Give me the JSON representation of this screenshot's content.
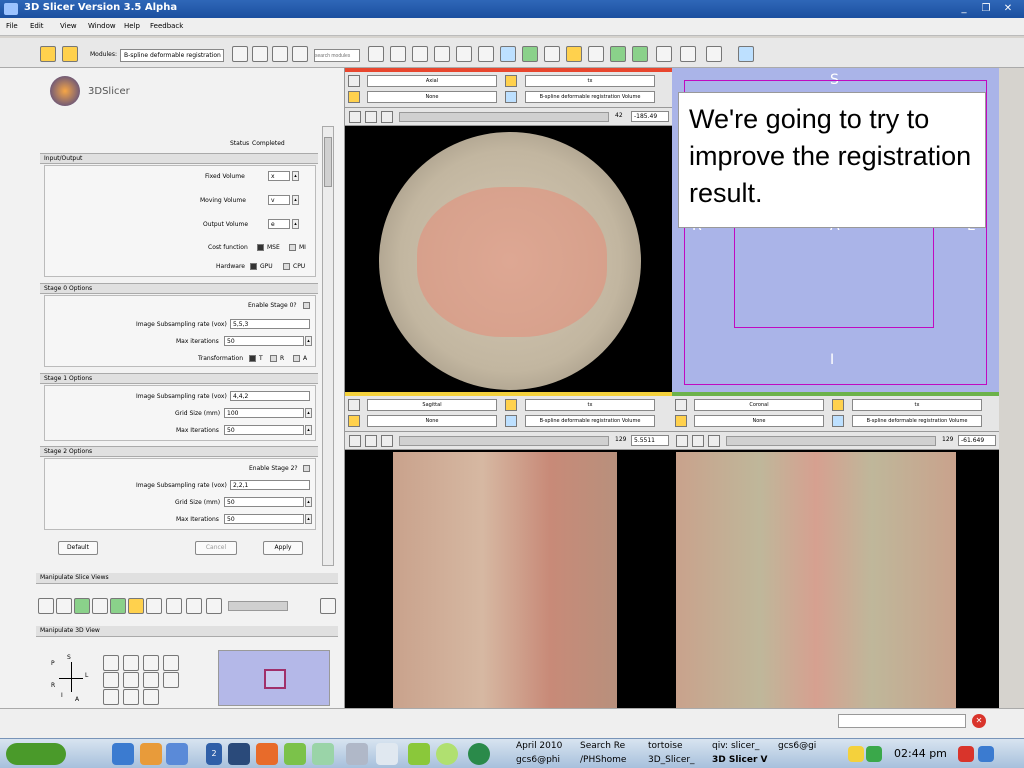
{
  "window": {
    "title": "3D Slicer Version 3.5 Alpha"
  },
  "menu": [
    "File",
    "Edit",
    "View",
    "Window",
    "Help",
    "Feedback"
  ],
  "toolbar": {
    "modules_label": "Modules:",
    "module_select": "B-spline deformable registration",
    "search_placeholder": "search modules"
  },
  "logo": {
    "text": "3DSlicer"
  },
  "module": {
    "status_label": "Status",
    "status_value": "Completed",
    "io_section": "Input/Output",
    "fixed_label": "Fixed Volume",
    "fixed_value": "x",
    "moving_label": "Moving Volume",
    "moving_value": "v",
    "output_label": "Output Volume",
    "output_value": "e",
    "cost_label": "Cost function",
    "cost_opt1": "MSE",
    "cost_opt2": "MI",
    "hw_label": "Hardware",
    "hw_opt1": "GPU",
    "hw_opt2": "CPU",
    "stage0_section": "Stage 0 Options",
    "stage0_enable": "Enable Stage 0?",
    "stage0_subsamp_label": "Image Subsampling rate (vox)",
    "stage0_subsamp_value": "5,5,3",
    "stage0_maxit_label": "Max iterations",
    "stage0_maxit_value": "50",
    "stage0_transform_label": "Transformation",
    "transform_t": "T",
    "transform_r": "R",
    "transform_a": "A",
    "stage1_section": "Stage 1 Options",
    "stage1_subsamp_label": "Image Subsampling rate (vox)",
    "stage1_subsamp_value": "4,4,2",
    "stage1_grid_label": "Grid Size (mm)",
    "stage1_grid_value": "100",
    "stage1_maxit_label": "Max Iterations",
    "stage1_maxit_value": "50",
    "stage2_section": "Stage 2 Options",
    "stage2_enable": "Enable Stage 2?",
    "stage2_subsamp_label": "Image Subsampling rate (vox)",
    "stage2_subsamp_value": "2,2,1",
    "stage2_grid_label": "Grid Size (mm)",
    "stage2_grid_value": "50",
    "stage2_maxit_label": "Max Iterations",
    "stage2_maxit_value": "50",
    "default_button": "Default",
    "cancel_button": "Cancel",
    "apply_button": "Apply"
  },
  "manip_slice": {
    "title": "Manipulate Slice Views"
  },
  "manip_3d": {
    "title": "Manipulate 3D View",
    "orient": {
      "p": "P",
      "s": "S",
      "r": "R",
      "l": "L",
      "i": "I",
      "a": "A"
    }
  },
  "views": {
    "axial": {
      "orientation": "Axial",
      "fg": "tx",
      "lbl": "None",
      "bg": "B-spline deformable registration Volume",
      "slice": "42",
      "offset": "-185.49"
    },
    "sagittal": {
      "orientation": "Sagittal",
      "fg": "tx",
      "lbl": "None",
      "bg": "B-spline deformable registration Volume",
      "slice": "129",
      "offset": "5.5511"
    },
    "coronal": {
      "orientation": "Coronal",
      "fg": "tx",
      "lbl": "None",
      "bg": "B-spline deformable registration Volume",
      "slice": "129",
      "offset": "-61.649"
    },
    "three_d": {
      "label_s": "S",
      "label_r": "R",
      "label_l": "L",
      "label_a": "A",
      "label_i": "I"
    }
  },
  "overlay_note": "We're going to try to improve the registration result.",
  "taskbar": {
    "desktop_count": "2",
    "items": [
      "April 2010",
      "Search Re",
      "tortoise",
      "qiv: slicer_",
      "gcs6@gi",
      "gcs6@phi",
      "/PHShome",
      "3D_Slicer_",
      "3D Slicer V"
    ],
    "clock": "02:44 pm"
  },
  "colors": {
    "axial_bar": "#e8462e",
    "sagittal_bar": "#f4d13c",
    "coronal_bar": "#6cb24a",
    "three_d_bg": "#aab4e8",
    "overlay_pink": "#e59a8a"
  }
}
